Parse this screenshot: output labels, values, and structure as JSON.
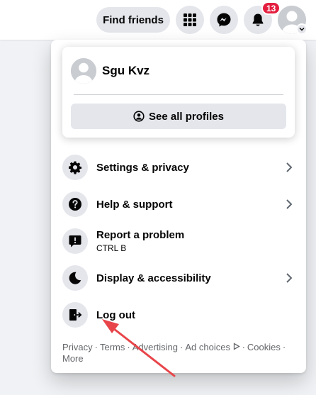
{
  "header": {
    "find_friends_label": "Find friends",
    "notifications_count": "13"
  },
  "profile": {
    "name": "Sgu Kvz",
    "see_all_profiles_label": "See all profiles"
  },
  "menu": {
    "items": [
      {
        "label": "Settings & privacy",
        "icon": "gear-icon",
        "has_chevron": true
      },
      {
        "label": "Help & support",
        "icon": "question-icon",
        "has_chevron": true
      },
      {
        "label": "Report a problem",
        "shortcut": "CTRL B",
        "icon": "report-icon",
        "has_chevron": false
      },
      {
        "label": "Display & accessibility",
        "icon": "moon-icon",
        "has_chevron": true
      },
      {
        "label": "Log out",
        "icon": "logout-icon",
        "has_chevron": false
      }
    ]
  },
  "footer": {
    "links": [
      "Privacy",
      "Terms",
      "Advertising",
      "Ad choices",
      "Cookies",
      "More"
    ],
    "separator": "·"
  },
  "annotation": {
    "color": "#e8454a"
  }
}
